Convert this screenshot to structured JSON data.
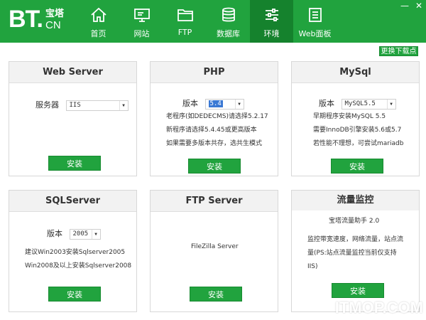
{
  "app": {
    "logo_main": "BT.",
    "logo_zh": "宝塔",
    "logo_cn": "CN"
  },
  "nav": [
    {
      "label": "首页",
      "icon": "home-icon"
    },
    {
      "label": "网站",
      "icon": "monitor-icon"
    },
    {
      "label": "FTP",
      "icon": "folder-icon"
    },
    {
      "label": "数据库",
      "icon": "database-icon"
    },
    {
      "label": "环境",
      "icon": "sliders-icon",
      "active": true
    },
    {
      "label": "Web面板",
      "icon": "panel-list-icon"
    }
  ],
  "window_controls": {
    "minimize": "—",
    "close": "✕"
  },
  "download_node_button": "更换下载点",
  "cards": {
    "web_server": {
      "title": "Web Server",
      "label": "服务器",
      "value": "IIS",
      "install": "安装"
    },
    "php": {
      "title": "PHP",
      "label": "版本",
      "value": "5.4",
      "notes": [
        "老程序(如DEDECMS)请选择5.2.17",
        "新程序请选择5.4.45或更高版本",
        "如果需要多版本共存，选共生模式"
      ],
      "install": "安装"
    },
    "mysql": {
      "title": "MySql",
      "label": "版本",
      "value": "MySQL5.5",
      "notes": [
        "早期程序安装MySQL 5.5",
        "需要InnoDB引擎安装5.6或5.7",
        "若性能不理想，可尝试mariadb"
      ],
      "install": "安装"
    },
    "sqlserver": {
      "title": "SQLServer",
      "label": "版本",
      "value": "2005",
      "notes": [
        "建议Win2003安装Sqlserver2005",
        "Win2008及以上安装Sqlserver2008"
      ],
      "install": "安装"
    },
    "ftp": {
      "title": "FTP Server",
      "value": "FileZilla Server",
      "install": "安装"
    },
    "traffic": {
      "title": "流量监控",
      "subtitle": "宝塔流量助手 2.0",
      "notes": [
        "监控带宽速度，网络流量，站点流",
        "量(PS:站点流量监控当前仅支持",
        "IIS)"
      ],
      "install": "安装"
    }
  },
  "watermark": "ITMOP.COM"
}
